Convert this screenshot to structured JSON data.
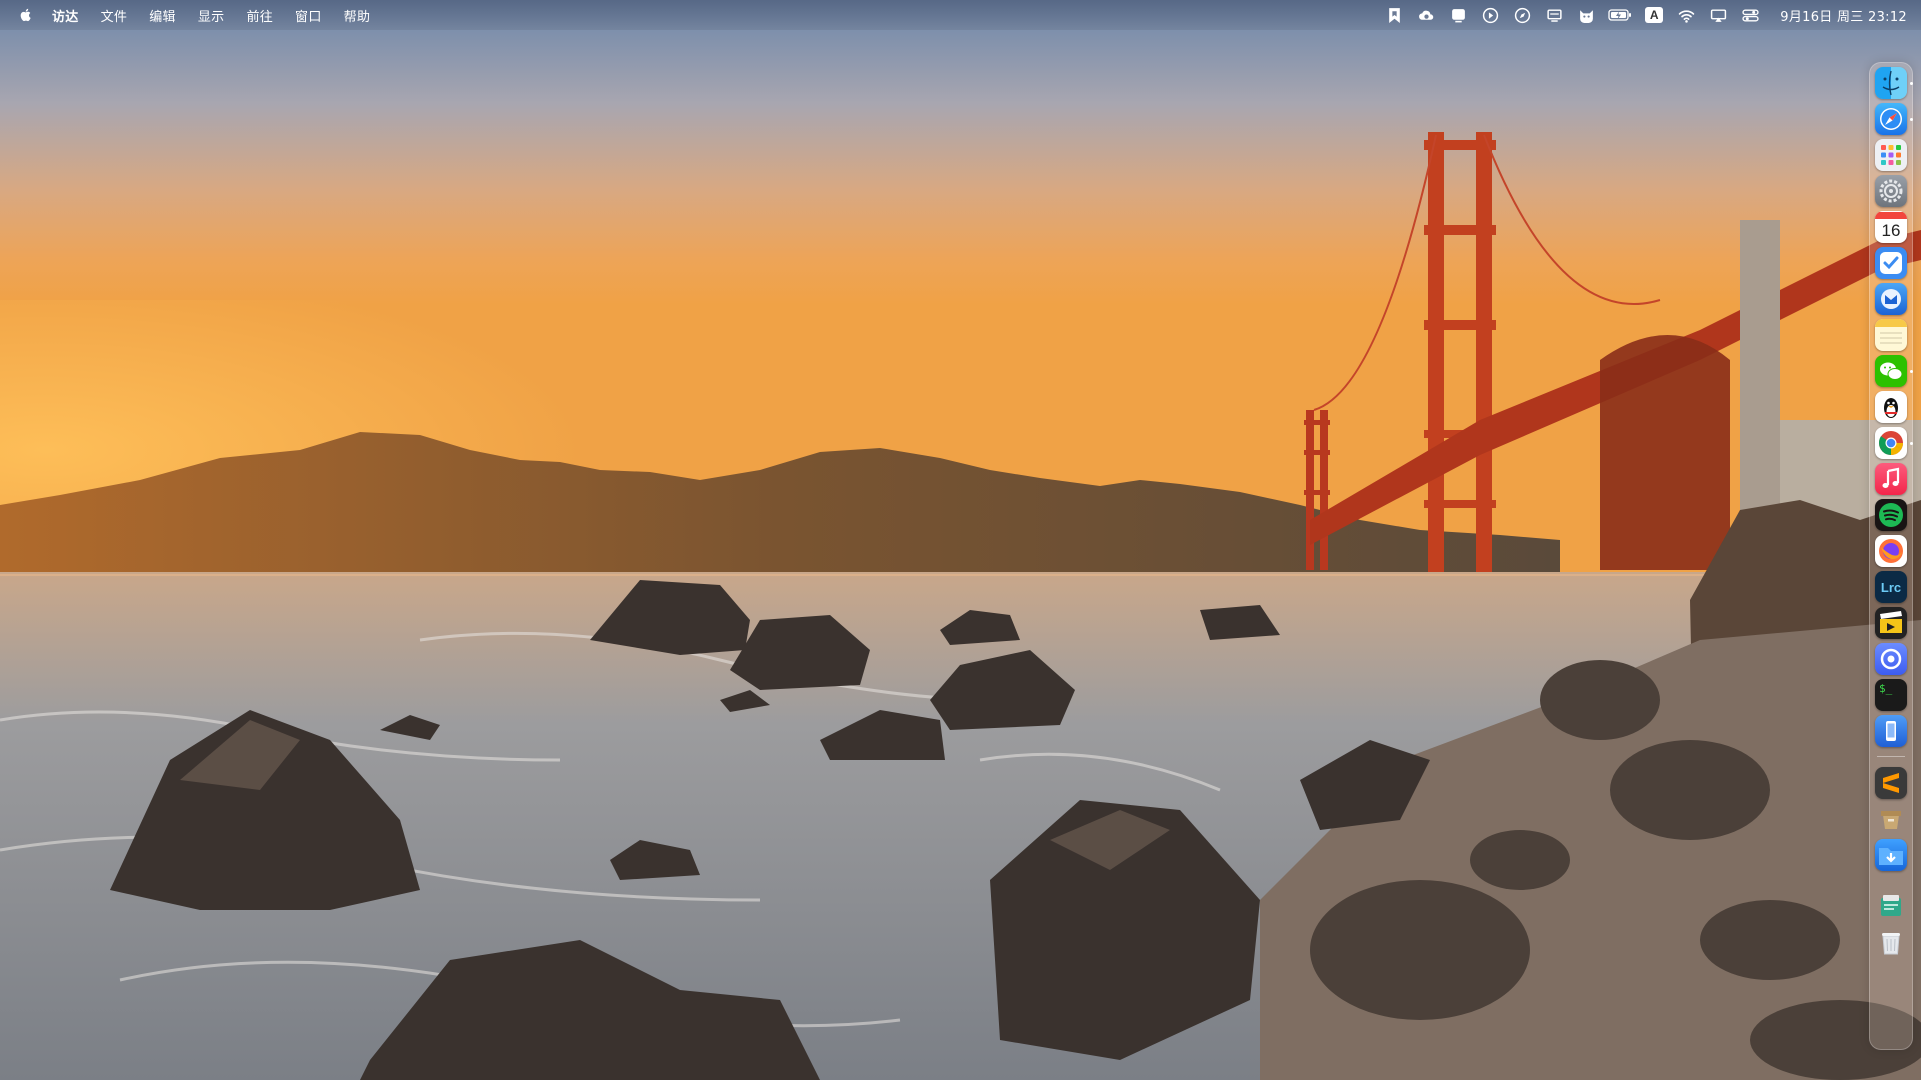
{
  "menubar": {
    "apple_icon": "apple-icon",
    "menus": [
      "访达",
      "文件",
      "编辑",
      "显示",
      "前往",
      "窗口",
      "帮助"
    ],
    "status_icons": [
      "bookmark-icon",
      "cloud-sync-icon",
      "display-icon",
      "play-circle-icon",
      "compass-icon",
      "monitor-icon",
      "cat-icon",
      "battery-icon",
      "input-source-icon",
      "wifi-icon",
      "screen-mirror-icon",
      "control-center-icon"
    ],
    "input_source_label": "A",
    "clock": "9月16日 周三 23:12"
  },
  "dock": {
    "apps": [
      {
        "name": "finder",
        "icon": "finder-icon",
        "running": true
      },
      {
        "name": "safari",
        "icon": "safari-icon",
        "running": true
      },
      {
        "name": "launchpad",
        "icon": "launchpad-icon",
        "running": false
      },
      {
        "name": "system-preferences",
        "icon": "gear-icon",
        "running": false
      },
      {
        "name": "calendar",
        "icon": "calendar-icon",
        "day": "16",
        "running": false
      },
      {
        "name": "things",
        "icon": "checkmark-icon",
        "running": false
      },
      {
        "name": "mail",
        "icon": "mail-icon",
        "running": false
      },
      {
        "name": "notes",
        "icon": "notes-icon",
        "running": false
      },
      {
        "name": "wechat",
        "icon": "wechat-icon",
        "running": true
      },
      {
        "name": "qq",
        "icon": "penguin-icon",
        "running": false
      },
      {
        "name": "chrome",
        "icon": "chrome-icon",
        "running": true
      },
      {
        "name": "music",
        "icon": "music-note-icon",
        "running": false
      },
      {
        "name": "spotify",
        "icon": "spotify-icon",
        "running": false
      },
      {
        "name": "firefox",
        "icon": "firefox-icon",
        "running": false
      },
      {
        "name": "lightroom-classic",
        "icon": "lrc-icon",
        "label": "Lrc",
        "running": false
      },
      {
        "name": "final-cut",
        "icon": "film-clapper-icon",
        "running": false
      },
      {
        "name": "proxyman",
        "icon": "proxy-icon",
        "running": false
      },
      {
        "name": "terminal",
        "icon": "terminal-icon",
        "label": "$_",
        "running": false
      },
      {
        "name": "xcode-simulator",
        "icon": "phone-icon",
        "running": false
      }
    ],
    "extras": [
      {
        "name": "sublime",
        "icon": "sublime-icon",
        "running": false
      },
      {
        "name": "archive",
        "icon": "archive-icon",
        "running": false
      },
      {
        "name": "downloads",
        "icon": "downloads-folder-icon",
        "running": false
      },
      {
        "name": "documents",
        "icon": "document-stack-icon",
        "running": false
      },
      {
        "name": "trash",
        "icon": "trash-icon",
        "running": false
      }
    ]
  }
}
